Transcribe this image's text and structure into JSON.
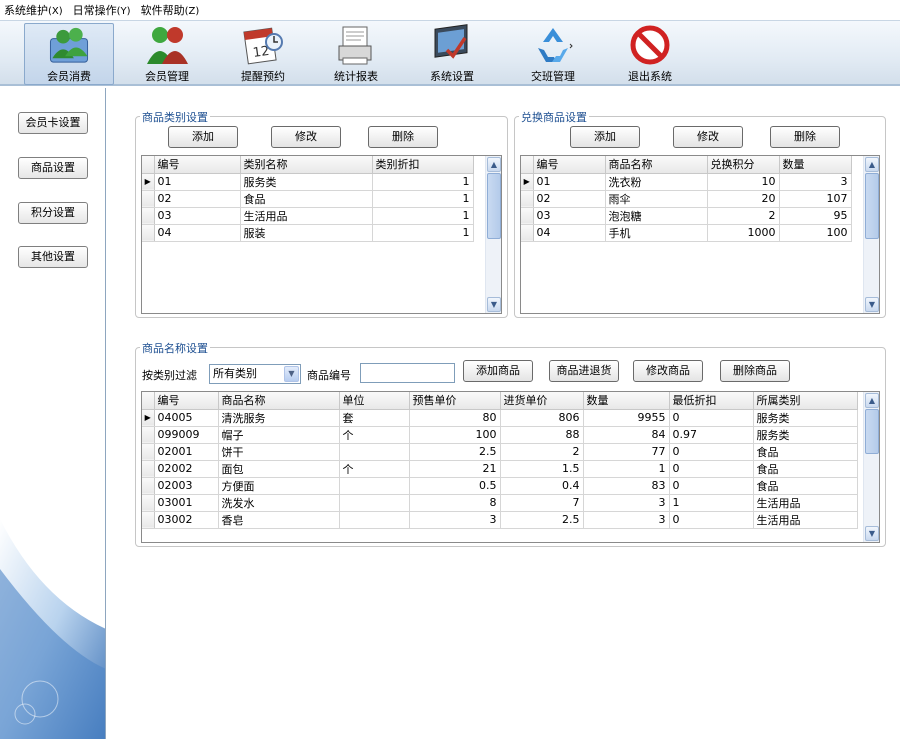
{
  "menu": [
    {
      "label": "系统维护",
      "accel": "(X)"
    },
    {
      "label": "日常操作",
      "accel": "(Y)"
    },
    {
      "label": "软件帮助",
      "accel": "(Z)"
    }
  ],
  "toolbar": [
    {
      "label": "会员消费",
      "icon": "members-icon",
      "active": true
    },
    {
      "label": "会员管理",
      "icon": "member-management-icon"
    },
    {
      "label": "提醒预约",
      "icon": "calendar-icon"
    },
    {
      "label": "统计报表",
      "icon": "report-icon"
    },
    {
      "label": "系统设置",
      "icon": "settings-icon"
    },
    {
      "label": "交班管理",
      "icon": "shift-recycle-icon"
    },
    {
      "label": "退出系统",
      "icon": "exit-icon"
    }
  ],
  "sidebar": [
    {
      "label": "会员卡设置"
    },
    {
      "label": "商品设置"
    },
    {
      "label": "积分设置"
    },
    {
      "label": "其他设置"
    }
  ],
  "category_group": {
    "title": "商品类别设置",
    "add_label": "添加",
    "edit_label": "修改",
    "delete_label": "删除",
    "columns": [
      "编号",
      "类别名称",
      "类别折扣"
    ],
    "rows": [
      [
        "01",
        "服务类",
        "1"
      ],
      [
        "02",
        "食品",
        "1"
      ],
      [
        "03",
        "生活用品",
        "1"
      ],
      [
        "04",
        "服装",
        "1"
      ]
    ]
  },
  "exchange_group": {
    "title": "兑换商品设置",
    "add_label": "添加",
    "edit_label": "修改",
    "delete_label": "删除",
    "columns": [
      "编号",
      "商品名称",
      "兑换积分",
      "数量"
    ],
    "rows": [
      [
        "01",
        "洗衣粉",
        "10",
        "3"
      ],
      [
        "02",
        "雨伞",
        "20",
        "107"
      ],
      [
        "03",
        "泡泡糖",
        "2",
        "95"
      ],
      [
        "04",
        "手机",
        "1000",
        "100"
      ]
    ]
  },
  "product_group": {
    "title": "商品名称设置",
    "filter_label": "按类别过滤",
    "filter_value": "所有类别",
    "code_label": "商品编号",
    "add_label": "添加商品",
    "stock_label": "商品进退货",
    "edit_label": "修改商品",
    "delete_label": "删除商品",
    "columns": [
      "编号",
      "商品名称",
      "单位",
      "预售单价",
      "进货单价",
      "数量",
      "最低折扣",
      "所属类别"
    ],
    "rows": [
      [
        "04005",
        "清洗服务",
        "套",
        "80",
        "806",
        "9955",
        "0",
        "服务类"
      ],
      [
        "099009",
        "帽子",
        "个",
        "100",
        "88",
        "84",
        "0.97",
        "服务类"
      ],
      [
        "02001",
        "饼干",
        "",
        "2.5",
        "2",
        "77",
        "0",
        "食品"
      ],
      [
        "02002",
        "面包",
        "个",
        "21",
        "1.5",
        "1",
        "0",
        "食品"
      ],
      [
        "02003",
        "方便面",
        "",
        "0.5",
        "0.4",
        "83",
        "0",
        "食品"
      ],
      [
        "03001",
        "洗发水",
        "",
        "8",
        "7",
        "3",
        "1",
        "生活用品"
      ],
      [
        "03002",
        "香皂",
        "",
        "3",
        "2.5",
        "3",
        "0",
        "生活用品"
      ]
    ]
  }
}
